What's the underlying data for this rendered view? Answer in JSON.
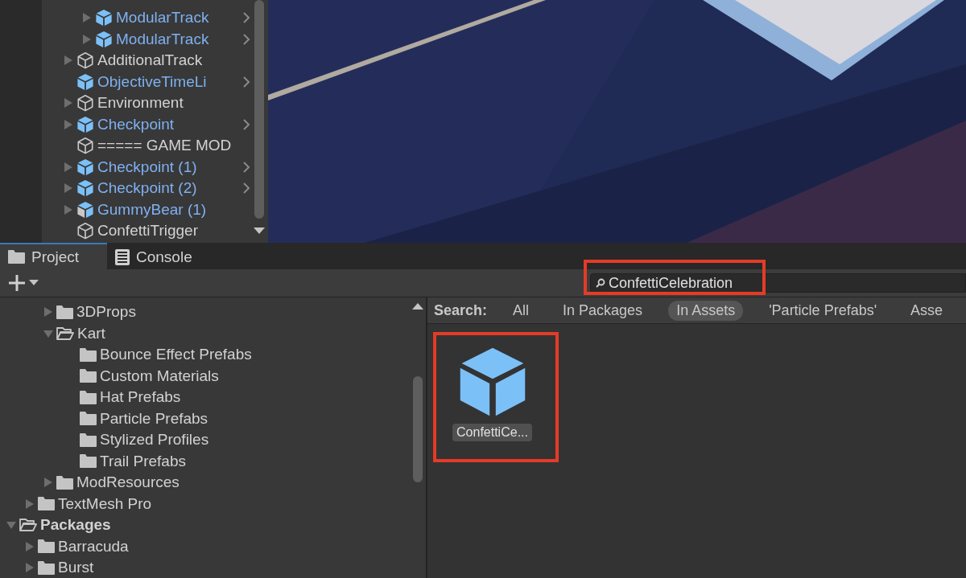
{
  "hierarchy": {
    "continued_children": [
      {
        "label": "ModularTrack",
        "kind": "prefab",
        "expandable": true,
        "has_prefab_arrow": true
      },
      {
        "label": "ModularTrack",
        "kind": "prefab",
        "expandable": true,
        "has_prefab_arrow": true
      }
    ],
    "items": [
      {
        "label": "AdditionalTrack",
        "kind": "object",
        "expandable": true,
        "has_prefab_arrow": false
      },
      {
        "label": "ObjectiveTimeLi",
        "kind": "prefab",
        "expandable": false,
        "has_prefab_arrow": true
      },
      {
        "label": "Environment",
        "kind": "object",
        "expandable": true,
        "has_prefab_arrow": false
      },
      {
        "label": "Checkpoint",
        "kind": "prefab",
        "expandable": true,
        "has_prefab_arrow": true
      },
      {
        "label": "===== GAME MOD",
        "kind": "object",
        "expandable": false,
        "has_prefab_arrow": false
      },
      {
        "label": "Checkpoint (1)",
        "kind": "prefab",
        "expandable": true,
        "has_prefab_arrow": true
      },
      {
        "label": "Checkpoint (2)",
        "kind": "prefab",
        "expandable": true,
        "has_prefab_arrow": true
      },
      {
        "label": "GummyBear (1)",
        "kind": "variant",
        "expandable": true,
        "has_prefab_arrow": false
      },
      {
        "label": "ConfettiTrigger",
        "kind": "object",
        "expandable": false,
        "has_prefab_arrow": false
      }
    ]
  },
  "tabs": [
    {
      "label": "Project",
      "kind": "folder",
      "selected": true
    },
    {
      "label": "Console",
      "kind": "console",
      "selected": false
    }
  ],
  "search": {
    "value": "ConfettiCelebration",
    "highlight": true
  },
  "project_tree": {
    "continued_children": [
      {
        "label": "3DProps",
        "expanded": false
      },
      {
        "label": "Kart",
        "expanded": true,
        "children": [
          {
            "label": "Bounce Effect Prefabs"
          },
          {
            "label": "Custom Materials"
          },
          {
            "label": "Hat Prefabs"
          },
          {
            "label": "Particle Prefabs"
          },
          {
            "label": "Stylized Profiles"
          },
          {
            "label": "Trail Prefabs"
          }
        ]
      },
      {
        "label": "ModResources",
        "expanded": false
      }
    ],
    "items": [
      {
        "label": "TextMesh Pro",
        "expanded": false,
        "bold": false
      },
      {
        "label": "Packages",
        "expanded": true,
        "bold": true,
        "children": [
          {
            "label": "Barracuda",
            "expanded": false
          },
          {
            "label": "Burst",
            "expanded": false
          }
        ]
      }
    ]
  },
  "search_filters": {
    "label": "Search:",
    "options": [
      {
        "label": "All",
        "selected": false
      },
      {
        "label": "In Packages",
        "selected": false
      },
      {
        "label": "In Assets",
        "selected": true
      },
      {
        "label": "'Particle Prefabs'",
        "selected": false
      },
      {
        "label": "Asse",
        "selected": false
      }
    ]
  },
  "assets": [
    {
      "label": "ConfettiCe...",
      "kind": "prefab",
      "highlight": true
    }
  ]
}
